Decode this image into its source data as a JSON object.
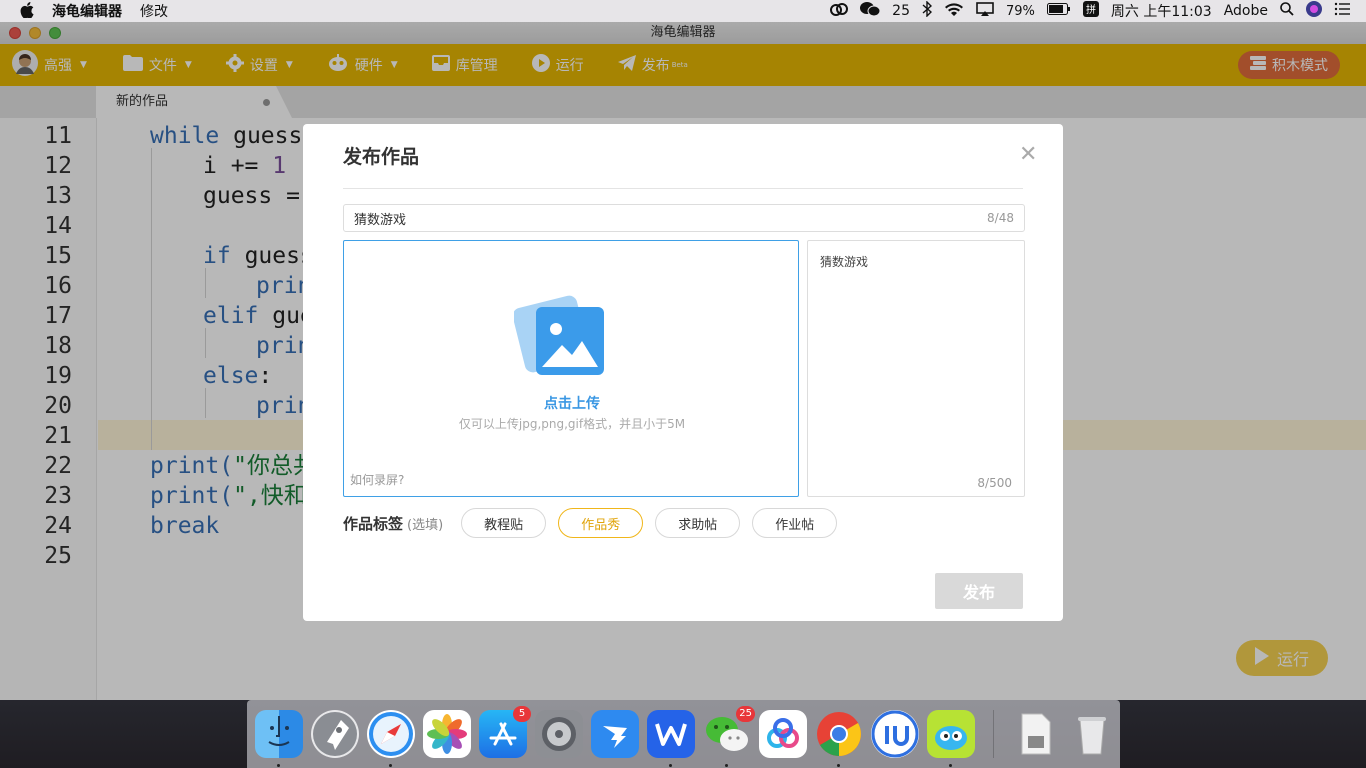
{
  "menubar": {
    "app_name": "海龟编辑器",
    "menu_edit": "修改",
    "wechat_count": "25",
    "battery": "79%",
    "clock": "周六 上午11:03",
    "adobe": "Adobe"
  },
  "window": {
    "title": "海龟编辑器"
  },
  "toolbar": {
    "user": "高强",
    "file": "文件",
    "settings": "设置",
    "hardware": "硬件",
    "library": "库管理",
    "run": "运行",
    "publish": "发布",
    "publish_sup": "Beta",
    "mode": "积木模式"
  },
  "tab": {
    "name": "新的作品"
  },
  "editor": {
    "line_numbers": [
      "11",
      "12",
      "13",
      "14",
      "15",
      "16",
      "17",
      "18",
      "19",
      "20",
      "21",
      "22",
      "23",
      "24",
      "25"
    ],
    "lines": [
      [
        "while",
        "guess"
      ],
      [
        "i += ",
        "1"
      ],
      [
        "guess = ",
        ""
      ],
      [
        "",
        ""
      ],
      [
        "if",
        "guess"
      ],
      [
        "prin",
        ""
      ],
      [
        "elif",
        "gue"
      ],
      [
        "prin",
        ""
      ],
      [
        "else",
        ":"
      ],
      [
        "prin",
        ""
      ],
      [
        "",
        ""
      ],
      [
        "print(",
        "\"你总共"
      ],
      [
        "print(",
        "\",快和"
      ],
      [
        "break",
        ""
      ],
      [
        "",
        ""
      ]
    ]
  },
  "run_float": {
    "label": "运行"
  },
  "dialog": {
    "title": "发布作品",
    "title_value": "猜数游戏",
    "title_count": "8/48",
    "upload_label": "点击上传",
    "upload_hint": "仅可以上传jpg,png,gif格式，并且小于5M",
    "howto": "如何录屏?",
    "desc_text": "猜数游戏",
    "desc_count": "8/500",
    "tags_label": "作品标签",
    "tags_optional": "(选填)",
    "tags": [
      "教程贴",
      "作品秀",
      "求助帖",
      "作业帖"
    ],
    "active_tag": "作品秀",
    "publish_button": "发布"
  },
  "dock": {
    "apps": [
      "finder",
      "launchpad",
      "safari",
      "photos",
      "app-store",
      "system-preferences",
      "dingtalk",
      "wps",
      "wechat",
      "baidu-netdisk",
      "chrome",
      "iu",
      "turtle-editor",
      "disk-image",
      "trash"
    ],
    "app_store_badge": "5",
    "wechat_badge": "25"
  },
  "colors": {
    "toolbar_bg": "#e6b803",
    "mode_btn": "#e16c3c",
    "upload_blue": "#3a97e3",
    "active_tag": "#f0b61a"
  }
}
